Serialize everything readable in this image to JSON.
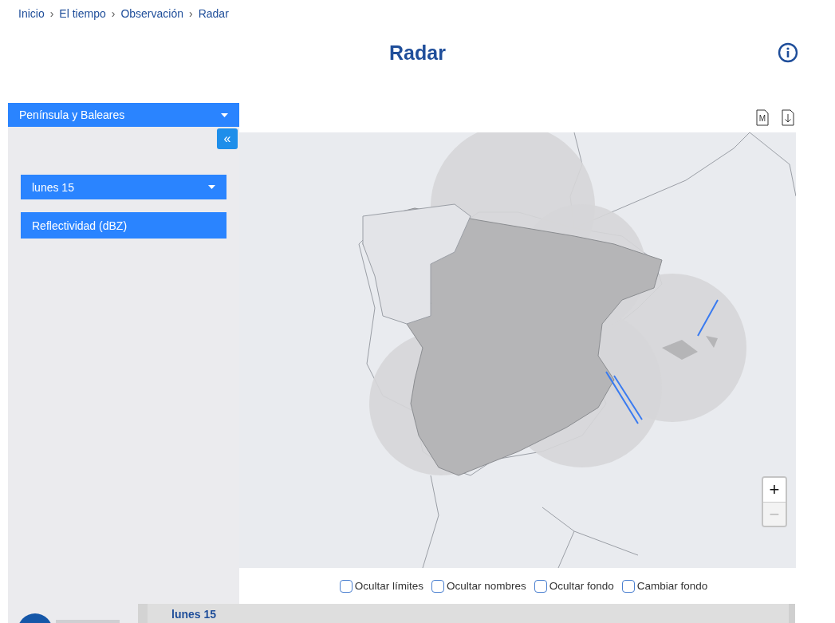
{
  "breadcrumb": {
    "separator": "›",
    "items": [
      "Inicio",
      "El tiempo",
      "Observación",
      "Radar"
    ]
  },
  "title": "Radar",
  "region_select": {
    "value": "Península y Baleares"
  },
  "collapse_button": "«",
  "date_select": {
    "value": "lunes 15"
  },
  "product_button": "Reflectividad (dBZ)",
  "map_toolbar": [
    {
      "kind": "map",
      "label": "M"
    },
    {
      "kind": "download"
    }
  ],
  "map": {
    "zoom_in": {
      "label": "+",
      "disabled": false
    },
    "zoom_out": {
      "label": "−",
      "disabled": true
    }
  },
  "options": [
    {
      "label": "Ocultar límites",
      "checked": false
    },
    {
      "label": "Ocultar nombres",
      "checked": false
    },
    {
      "label": "Ocultar fondo",
      "checked": false
    },
    {
      "label": "Cambiar fondo",
      "checked": false
    }
  ],
  "timeline": {
    "day": "lunes 15"
  }
}
